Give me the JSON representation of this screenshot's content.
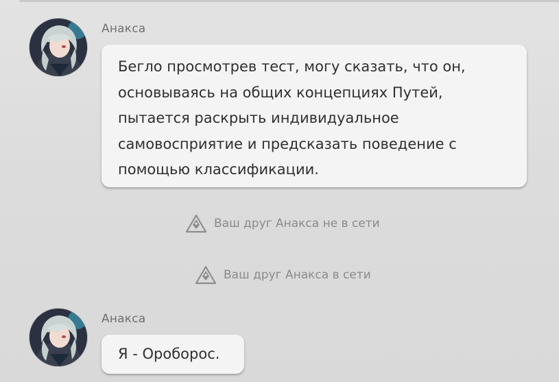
{
  "messages": [
    {
      "sender": "Анакса",
      "lines": [
        "Бегло просмотрев тест, могу сказать, что он,",
        "основываясь на общих концепциях Путей,",
        "пытается раскрыть индивидуальное",
        "самовосприятие и предсказать поведение с",
        "помощью классификации."
      ]
    },
    {
      "sender": "Анакса",
      "lines": [
        "Я - Оробoрос."
      ]
    }
  ],
  "notices": [
    {
      "text": "Ваш друг Анакса не в сети",
      "icon": "status-triangle-icon"
    },
    {
      "text": "Ваш друг Анакса в сети",
      "icon": "status-triangle-icon"
    }
  ],
  "colors": {
    "bubble_bg": "#f4f4f4",
    "page_bg": "#dcdcdc",
    "notice_text": "#8a8a8a",
    "sender_text": "#6f6f6f"
  }
}
